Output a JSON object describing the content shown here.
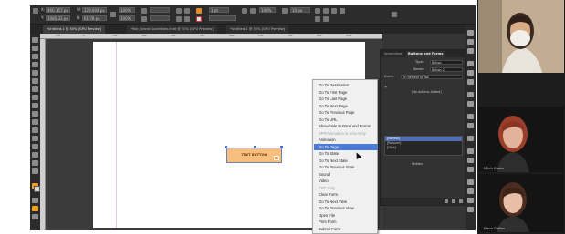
{
  "options_bar": {
    "x_value": "460.357 px",
    "y_value": "1085.33 px",
    "w_value": "229.004 px",
    "h_value": "61.78 px",
    "scale_x": "100%",
    "scale_y": "100%",
    "stroke_weight": "1 pt",
    "zoom": "100%",
    "opacity": "10 px"
  },
  "tabs": [
    {
      "label": "*Untitled-1 @ 50% [GPU Preview]"
    },
    {
      "label": "*Mar_Brand Guidelines.indd @ 50% [GPU Preview]"
    },
    {
      "label": "*Untitled-2 @ 50% [GPU Preview]"
    }
  ],
  "ruler_ticks": [
    "-100",
    "0",
    "100",
    "200",
    "300",
    "400",
    "500",
    "600",
    "700",
    "800",
    "900"
  ],
  "canvas": {
    "button_label": "TEXT BUTTON"
  },
  "panel": {
    "tab_inactive": "Interactive",
    "tab_active": "Buttons and Forms",
    "type_label": "Type:",
    "type_value": "Button",
    "name_label": "Name:",
    "name_value": "Button 2",
    "event_label": "Event:",
    "event_value": "On Release or Tap",
    "actions_label": "[No Actions Added]",
    "appearance_items": [
      "[Normal]",
      "[Rollover]",
      "[Click]"
    ],
    "hidden_label": "Hidden"
  },
  "dropdown_menu": {
    "items": [
      {
        "label": "Go To Destination",
        "state": "normal"
      },
      {
        "label": "Go To First Page",
        "state": "normal"
      },
      {
        "label": "Go To Last Page",
        "state": "normal"
      },
      {
        "label": "Go To Next Page",
        "state": "normal"
      },
      {
        "label": "Go To Previous Page",
        "state": "normal"
      },
      {
        "label": "Go To URL",
        "state": "normal"
      },
      {
        "label": "Show/Hide Buttons and Forms",
        "state": "normal"
      },
      {
        "label": "SPF/Animation in Unix-Only",
        "state": "disabled"
      },
      {
        "label": "Animation",
        "state": "normal"
      },
      {
        "label": "Go To Page",
        "state": "highlighted"
      },
      {
        "label": "Go To State",
        "state": "normal"
      },
      {
        "label": "Go To Next State",
        "state": "normal"
      },
      {
        "label": "Go To Previous State",
        "state": "normal"
      },
      {
        "label": "Sound",
        "state": "normal"
      },
      {
        "label": "Video",
        "state": "normal"
      },
      {
        "label": "PDF Only",
        "state": "disabled"
      },
      {
        "label": "Clear Form",
        "state": "normal"
      },
      {
        "label": "Go To Next View",
        "state": "normal"
      },
      {
        "label": "Go To Previous View",
        "state": "normal"
      },
      {
        "label": "Open File",
        "state": "normal"
      },
      {
        "label": "Print Form",
        "state": "normal"
      },
      {
        "label": "Submit Form",
        "state": "normal"
      }
    ]
  },
  "video_call": {
    "participants": [
      {
        "name": ""
      },
      {
        "name": "Mitch Gaeta"
      },
      {
        "name": "Elena Gaffan"
      }
    ]
  },
  "colors": {
    "menu_highlight": "#4b7bd6",
    "button_fill": "#f6bf7e",
    "selection_frame": "#6d7fbd",
    "panel_selection": "#4e6fb3"
  }
}
